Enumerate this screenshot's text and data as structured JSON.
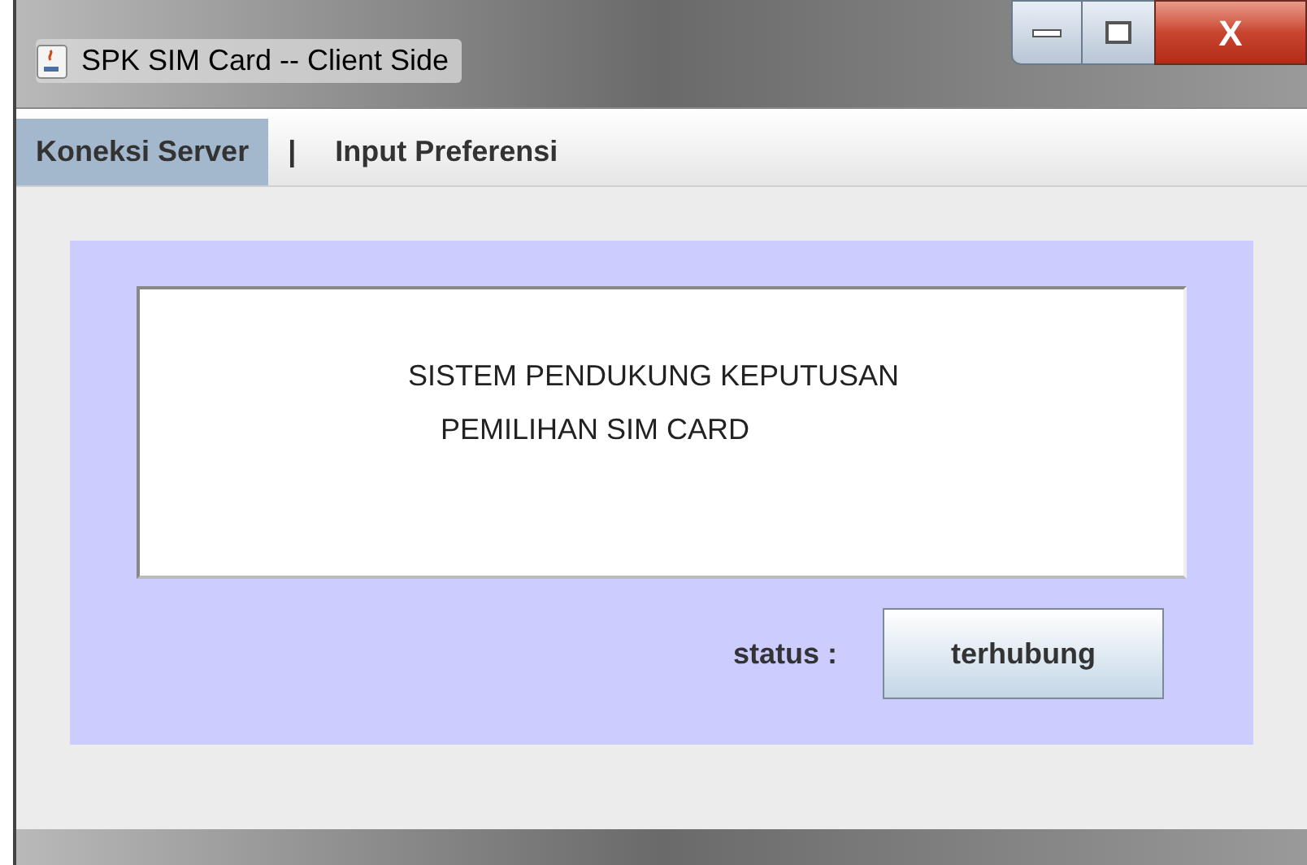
{
  "window": {
    "title": "SPK SIM Card -- Client Side",
    "controls": [
      {
        "kind": "minimize"
      },
      {
        "kind": "maximize"
      },
      {
        "kind": "close",
        "label": "X"
      }
    ]
  },
  "menu": [
    {
      "label": "Koneksi Server",
      "selected": true
    },
    {
      "label": "|",
      "selected": false
    },
    {
      "label": "Input Preferensi",
      "selected": false
    }
  ],
  "banner": {
    "lines": [
      "SISTEM PENDUKUNG KEPUTUSAN",
      "PEMILIHAN SIM CARD"
    ]
  },
  "status": {
    "label": "status :",
    "button": "terhubung"
  }
}
